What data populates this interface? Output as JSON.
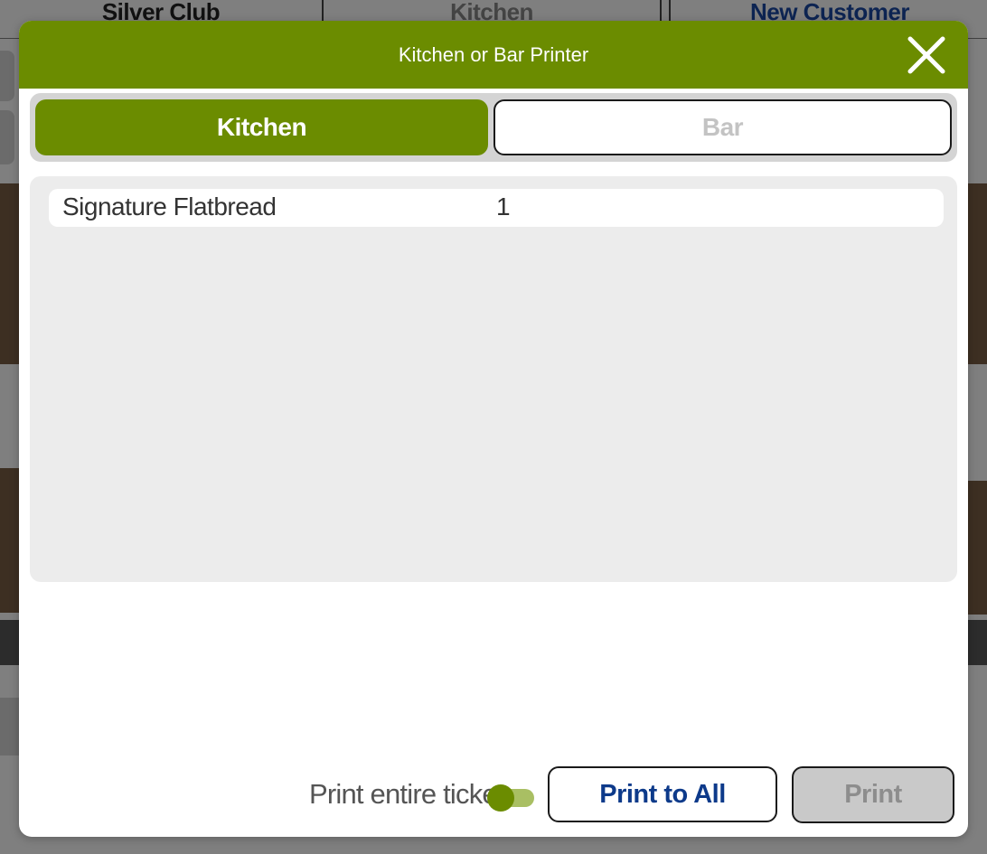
{
  "background": {
    "tabs": [
      {
        "label": "Silver Club"
      },
      {
        "label": "Kitchen"
      },
      {
        "label": "New Customer"
      }
    ]
  },
  "modal": {
    "title": "Kitchen or Bar Printer",
    "close_icon": "close-icon",
    "segments": [
      {
        "label": "Kitchen",
        "active": true
      },
      {
        "label": "Bar",
        "active": false
      }
    ],
    "items": [
      {
        "name": "Signature Flatbread",
        "qty": "1"
      }
    ],
    "footer": {
      "toggle_label": "Print entire ticket",
      "toggle_on": false,
      "print_all_label": "Print to All",
      "print_label": "Print"
    }
  },
  "colors": {
    "accent": "#6b8c00",
    "print_all_text": "#0d3a8a",
    "disabled": "#c9c9c9"
  }
}
